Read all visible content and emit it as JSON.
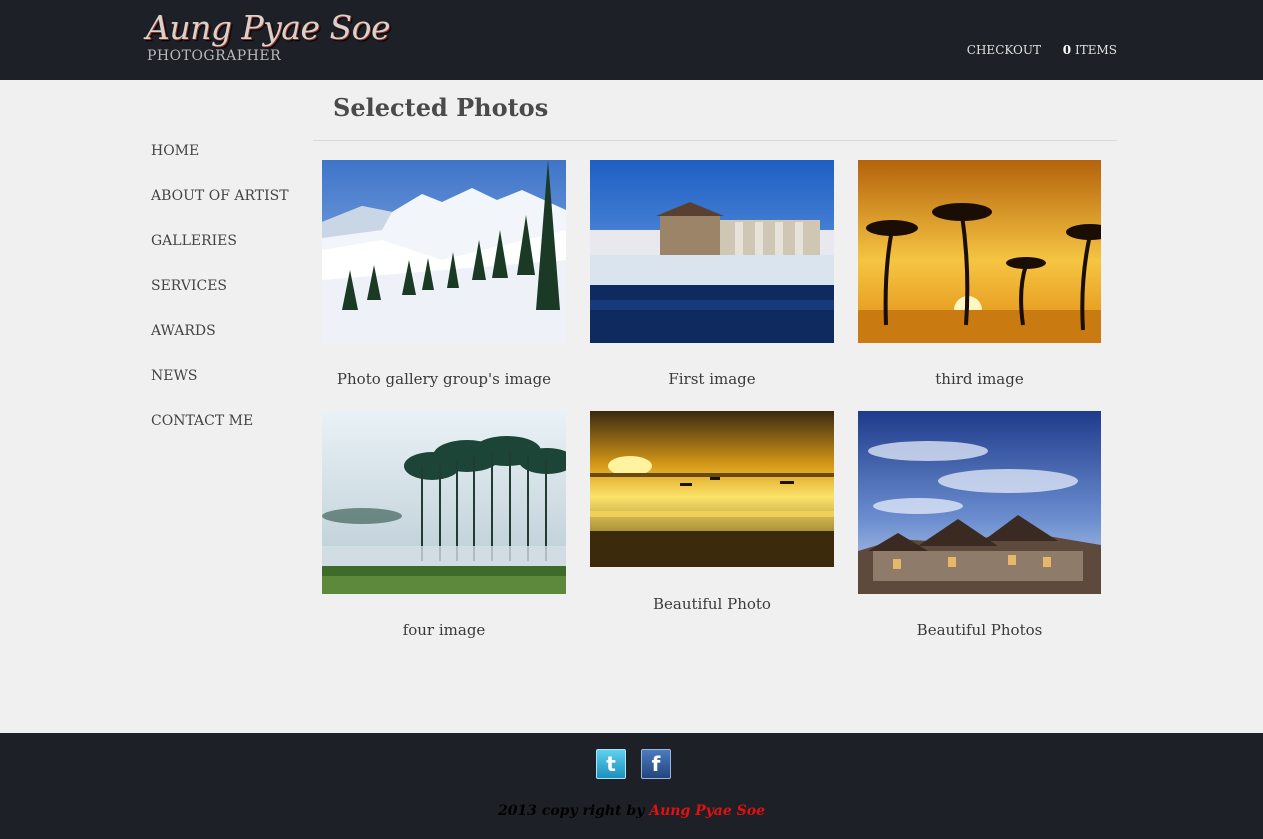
{
  "header": {
    "brand_name": "Aung Pyae Soe",
    "brand_sub": "PHOTOGRAPHER",
    "checkout": "CHECKOUT",
    "items_count": "0",
    "items_label": "ITEMS"
  },
  "nav": {
    "items": [
      {
        "label": "HOME"
      },
      {
        "label": "ABOUT OF ARTIST"
      },
      {
        "label": "GALLERIES"
      },
      {
        "label": "SERVICES"
      },
      {
        "label": "AWARDS"
      },
      {
        "label": "NEWS"
      },
      {
        "label": "CONTACT ME"
      }
    ]
  },
  "main": {
    "title": "Selected Photos",
    "photos": [
      {
        "caption": "Photo gallery group's image",
        "scene": "snowy-mountains"
      },
      {
        "caption": "First image",
        "scene": "mill-waterfall"
      },
      {
        "caption": "third image",
        "scene": "palm-sunset"
      },
      {
        "caption": "four image",
        "scene": "misty-forest"
      },
      {
        "caption": "Beautiful Photo",
        "scene": "golden-sea-sunset"
      },
      {
        "caption": "Beautiful Photos",
        "scene": "stone-house-sky"
      }
    ]
  },
  "footer": {
    "twitter_icon": "twitter-icon",
    "facebook_icon": "facebook-icon",
    "copyright_prefix": "2013 copy right by",
    "copyright_owner": "Aung Pyae Soe",
    "owner_color": "#e31010"
  },
  "colors": {
    "header_bg": "#1d2027",
    "page_bg": "#f0f0f0"
  }
}
